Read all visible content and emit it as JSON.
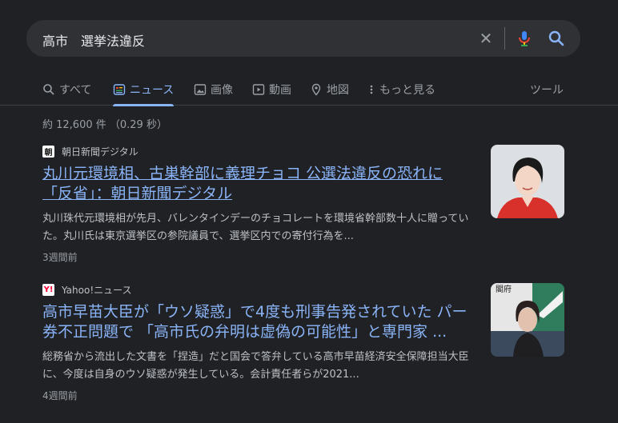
{
  "search": {
    "query": "高市　選挙法違反",
    "icons": [
      "close-icon",
      "microphone-icon",
      "search-icon"
    ]
  },
  "tabs": [
    {
      "label": "すべて",
      "icon": "search-icon"
    },
    {
      "label": "ニュース",
      "icon": "news-icon",
      "active": true
    },
    {
      "label": "画像",
      "icon": "image-icon"
    },
    {
      "label": "動画",
      "icon": "video-icon"
    },
    {
      "label": "地図",
      "icon": "map-pin-icon"
    },
    {
      "label": "もっと見る",
      "icon": "more-vert-icon"
    },
    {
      "label": "ツール"
    }
  ],
  "stats": "約 12,600 件 （0.29 秒）",
  "results": [
    {
      "source": "朝日新聞デジタル",
      "favicon": "朝",
      "title": "丸川元環境相、古巣幹部に義理チョコ 公選法違反の恐れに「反省」：朝日新聞デジタル",
      "snippet": "丸川珠代元環境相が先月、バレンタインデーのチョコレートを環境省幹部数十人に贈っていた。丸川氏は東京選挙区の参院議員で、選挙区内での寄付行為を...",
      "age": "3週間前"
    },
    {
      "source": "Yahoo!ニュース",
      "favicon": "Y!",
      "title": "高市早苗大臣が「ウソ疑惑」で4度も刑事告発されていた パー券不正問題で 「高市氏の弁明は虚偽の可能性」と専門家 ...",
      "snippet": "総務省から流出した文書を「捏造」だと国会で答弁している高市早苗経済安全保障担当大臣に、今度は自身のウソ疑惑が発生している。会計責任者らが2021...",
      "age": "4週間前",
      "thumb_text": "閣府"
    }
  ],
  "colors": {
    "background": "#202124",
    "search_bg": "#303134",
    "link": "#8ab4f8",
    "text": "#bdc1c6",
    "muted": "#9aa0a6"
  }
}
